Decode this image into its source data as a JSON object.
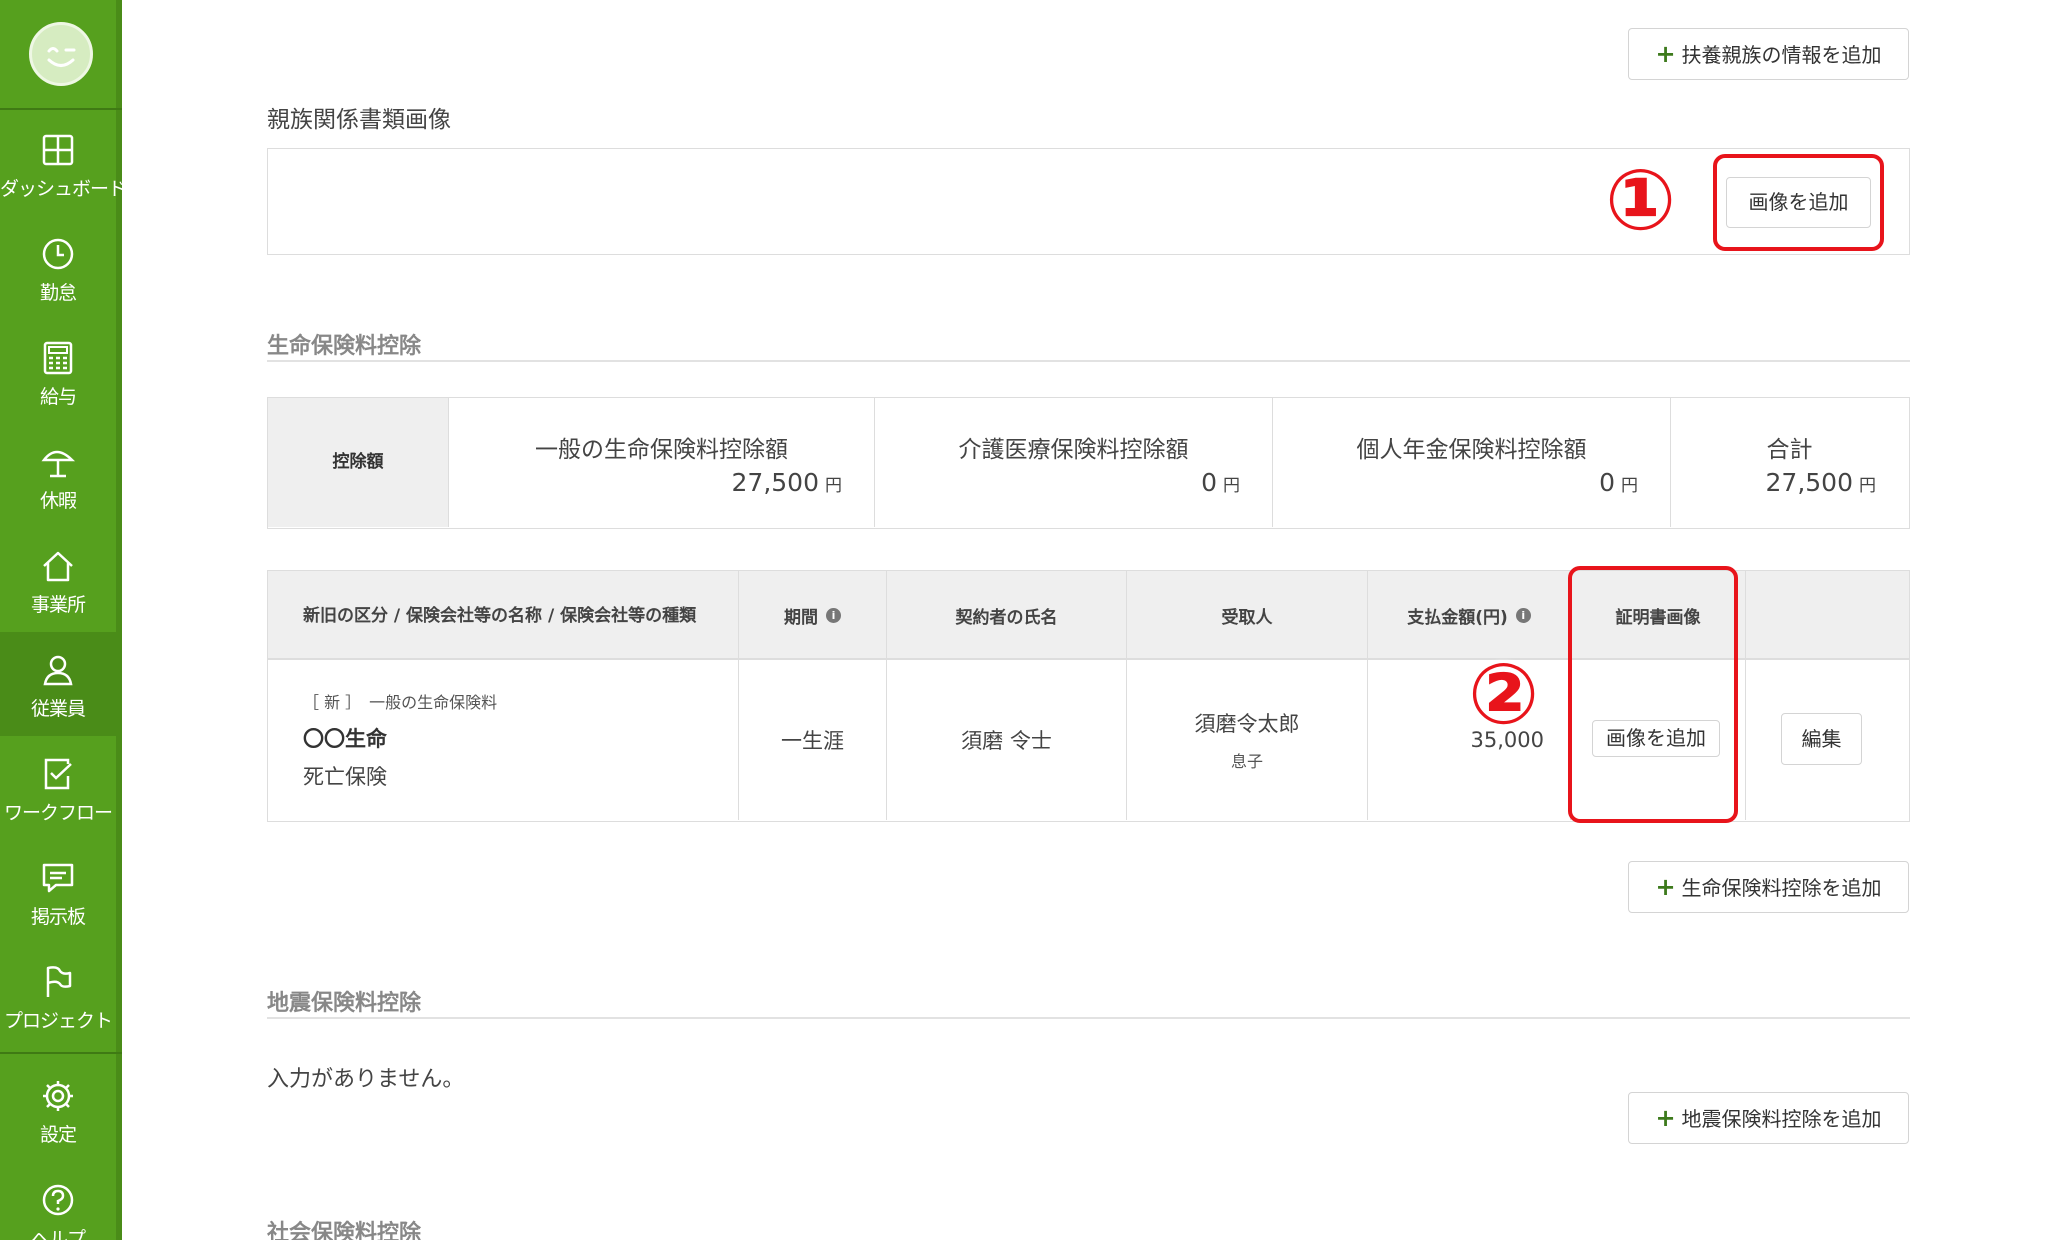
{
  "sidebar": {
    "items": [
      {
        "label": "ダッシュボード",
        "icon": "dashboard-icon"
      },
      {
        "label": "勤怠",
        "icon": "clock-icon"
      },
      {
        "label": "給与",
        "icon": "calculator-icon"
      },
      {
        "label": "休暇",
        "icon": "beach-umbrella-icon"
      },
      {
        "label": "事業所",
        "icon": "home-icon"
      },
      {
        "label": "従業員",
        "icon": "person-icon"
      },
      {
        "label": "ワークフロー",
        "icon": "checklist-icon"
      },
      {
        "label": "掲示板",
        "icon": "message-icon"
      },
      {
        "label": "プロジェクト",
        "icon": "flag-icon"
      }
    ],
    "settings": {
      "label": "設定",
      "icon": "gear-icon"
    },
    "help": {
      "label": "ヘルプ",
      "icon": "help-icon"
    },
    "active": "従業員",
    "colors": {
      "background": "#56a01e",
      "active": "#4a8c18"
    }
  },
  "dependents": {
    "add_button": "扶養親族の情報を追加",
    "doc_images_title": "親族関係書類画像",
    "add_image_button": "画像を追加"
  },
  "annotations": {
    "one": "①",
    "two": "②",
    "color": "#e8141b"
  },
  "life_insurance": {
    "title": "生命保険料控除",
    "summary": {
      "header": "控除額",
      "columns": [
        {
          "label": "一般の生命保険料控除額",
          "value": "27,500",
          "unit": "円"
        },
        {
          "label": "介護医療保険料控除額",
          "value": "0",
          "unit": "円"
        },
        {
          "label": "個人年金保険料控除額",
          "value": "0",
          "unit": "円"
        },
        {
          "label": "合計",
          "value": "27,500",
          "unit": "円"
        }
      ]
    },
    "table": {
      "headers": {
        "category": "新旧の区分 / 保険会社等の名称 / 保険会社等の種類",
        "period": "期間",
        "contractor": "契約者の氏名",
        "recipient": "受取人",
        "amount": "支払金額(円)",
        "certificate": "証明書画像"
      },
      "row": {
        "type_line": "［ 新 ］　一般の生命保険料",
        "company": "〇〇生命",
        "kind": "死亡保険",
        "period": "一生涯",
        "contractor": "須磨 令士",
        "recipient_name": "須磨令太郎",
        "recipient_relation": "息子",
        "amount": "35,000",
        "add_image_button": "画像を追加",
        "edit_button": "編集"
      }
    },
    "add_button": "生命保険料控除を追加"
  },
  "earthquake_insurance": {
    "title": "地震保険料控除",
    "empty_text": "入力がありません。",
    "add_button": "地震保険料控除を追加"
  },
  "social_insurance": {
    "title": "社会保険料控除"
  }
}
